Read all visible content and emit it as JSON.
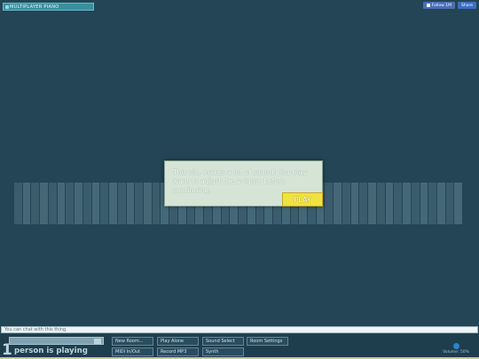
{
  "header": {
    "title": "MULTIPLAYER PIANO",
    "follow_label": "Follow 1M",
    "share_label": "Share"
  },
  "modal": {
    "message": "This site makes a lot of sound! You may want to adjust the volume before continuing.",
    "play_label": "PLAY"
  },
  "chat": {
    "placeholder": "You can chat with this thing."
  },
  "status": {
    "player_count": "1",
    "player_text": "person is playing"
  },
  "menu": {
    "new_room": "New Room...",
    "play_alone": "Play Alone",
    "sound_select": "Sound Select",
    "room_settings": "Room Settings",
    "midi_inout": "MIDI In/Out",
    "record_mp3": "Record MP3",
    "synth": "Synth"
  },
  "volume": {
    "label": "Volume: 50%",
    "level": 0.5
  },
  "colors": {
    "background": "#234556",
    "modal": "#d6e4d6",
    "play_button": "#f1e142",
    "volume_knob": "#2e7fd0"
  },
  "icons": [
    "thumbs-up-icon",
    "volume-knob-icon"
  ]
}
